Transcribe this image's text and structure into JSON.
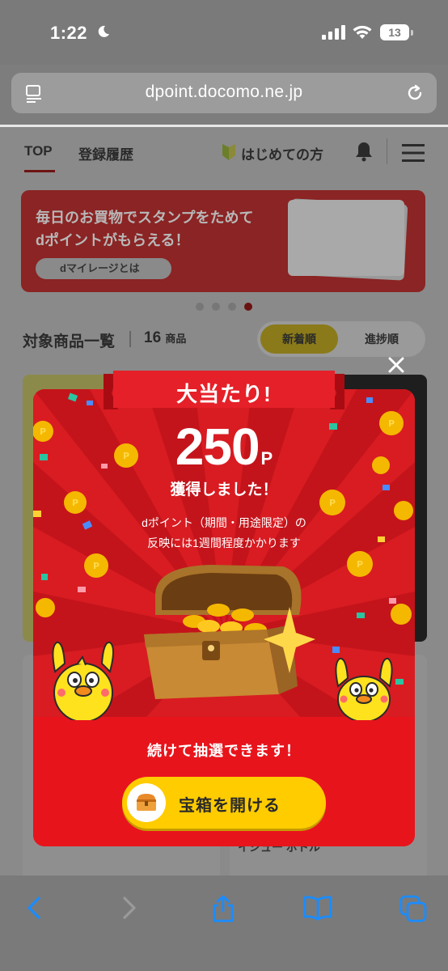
{
  "status_bar": {
    "time": "1:22",
    "battery": "13"
  },
  "browser": {
    "url": "dpoint.docomo.ne.jp"
  },
  "nav": {
    "top": "TOP",
    "history": "登録履歴",
    "beginner": "はじめての方"
  },
  "banner": {
    "line1": "毎日のお買物でスタンプをためて",
    "line2": "dポイントがもらえる！",
    "pill": "dマイレージとは"
  },
  "list": {
    "title": "対象商品一覧",
    "count": "16",
    "count_unit": "商品",
    "sort_new": "新着順",
    "sort_progress": "進捗順"
  },
  "background_text": "イシュー ボトル",
  "modal": {
    "ribbon": "大当たり!",
    "points_value": "250",
    "points_unit": "P",
    "gained": "獲得しました！",
    "note_line1": "dポイント（期間・用途限定）の",
    "note_line2": "反映には1週間程度かかります",
    "continue": "続けて抽選できます！",
    "open_button": "宝箱を開ける"
  },
  "colors": {
    "modal_red": "#d81c22",
    "button_yellow": "#ffcc00",
    "ios_blue": "#1a8cff"
  }
}
